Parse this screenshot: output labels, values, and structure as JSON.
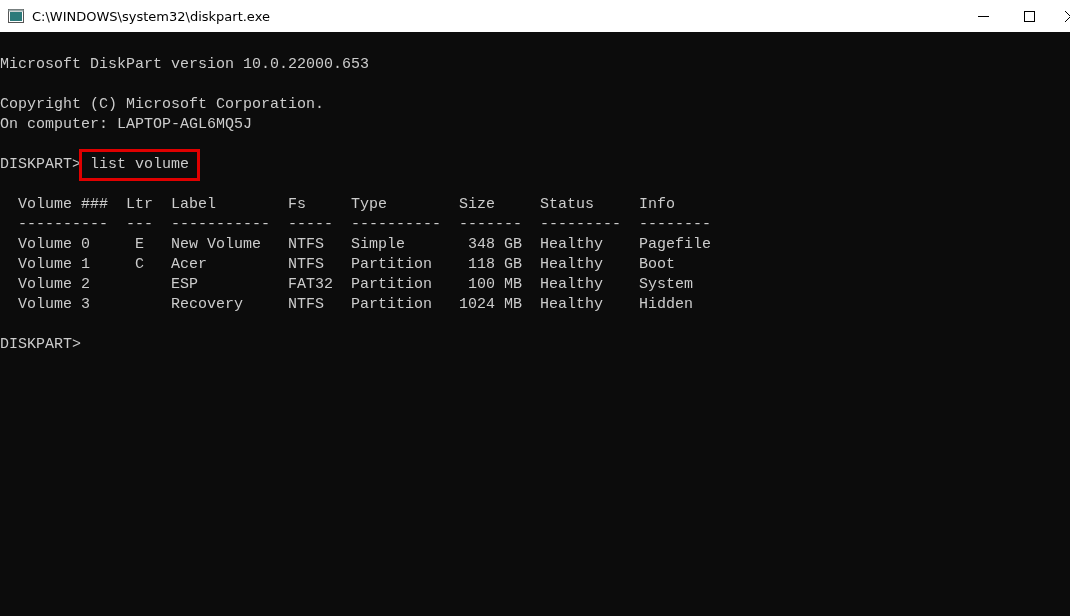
{
  "window": {
    "title": "C:\\WINDOWS\\system32\\diskpart.exe"
  },
  "console": {
    "header_blocks": [
      [
        "Microsoft DiskPart version 10.0.22000.653"
      ],
      [
        "Copyright (C) Microsoft Corporation.",
        "On computer: LAPTOP-AGL6MQ5J"
      ]
    ],
    "command": {
      "prompt": "DISKPART>",
      "text": "list volume",
      "highlighted": true
    },
    "table": {
      "columns": [
        {
          "label": "Volume ###",
          "rule": "----------"
        },
        {
          "label": "Ltr",
          "rule": "---"
        },
        {
          "label": "Label",
          "rule": "-----------"
        },
        {
          "label": "Fs",
          "rule": "-----"
        },
        {
          "label": "Type",
          "rule": "----------"
        },
        {
          "label": "Size",
          "rule": "-------"
        },
        {
          "label": "Status",
          "rule": "---------"
        },
        {
          "label": "Info",
          "rule": "--------"
        }
      ],
      "rows": [
        [
          "Volume 0",
          "E",
          "New Volume",
          "NTFS",
          "Simple",
          "348 GB",
          "Healthy",
          "Pagefile"
        ],
        [
          "Volume 1",
          "C",
          "Acer",
          "NTFS",
          "Partition",
          "118 GB",
          "Healthy",
          "Boot"
        ],
        [
          "Volume 2",
          null,
          "ESP",
          "FAT32",
          "Partition",
          "100 MB",
          "Healthy",
          "System"
        ],
        [
          "Volume 3",
          null,
          "Recovery",
          "NTFS",
          "Partition",
          "1024 MB",
          "Healthy",
          "Hidden"
        ]
      ]
    },
    "final_prompt": "DISKPART>"
  }
}
